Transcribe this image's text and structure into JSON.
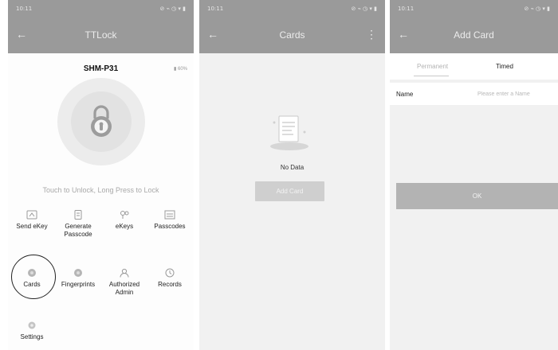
{
  "screen1": {
    "status": {
      "time": "10:11",
      "icons": "⊘ ⌁ ◷ ▾ ▮"
    },
    "appbar": {
      "back_icon": "arrow-left-icon",
      "title": "TTLock"
    },
    "device_name": "SHM-P31",
    "battery": "▮ 60%",
    "touch_hint": "Touch to Unlock, Long Press to Lock",
    "menu_items": [
      {
        "label": "Send eKey",
        "icon": "ekey-send-icon"
      },
      {
        "label": "Generate Passcode",
        "icon": "generate-passcode-icon"
      },
      {
        "label": "eKeys",
        "icon": "ekeys-icon"
      },
      {
        "label": "Passcodes",
        "icon": "passcodes-icon"
      },
      {
        "label": "Cards",
        "icon": "card-icon"
      },
      {
        "label": "Fingerprints",
        "icon": "fingerprint-icon"
      },
      {
        "label": "Authorized Admin",
        "icon": "admin-icon"
      },
      {
        "label": "Records",
        "icon": "records-icon"
      },
      {
        "label": "Settings",
        "icon": "settings-icon"
      }
    ]
  },
  "screen2": {
    "status": {
      "time": "10:11",
      "icons": "⊘ ⌁ ◷ ▾ ▮"
    },
    "appbar": {
      "back_icon": "arrow-left-icon",
      "title": "Cards",
      "more_icon": "more-vertical-icon"
    },
    "empty_text": "No Data",
    "add_button": "Add Card"
  },
  "screen3": {
    "status": {
      "time": "10:11",
      "icons": "⊘ ⌁ ◷ ▾ ▮"
    },
    "appbar": {
      "back_icon": "arrow-left-icon",
      "title": "Add Card"
    },
    "tabs": [
      "Permanent",
      "Timed"
    ],
    "name_label": "Name",
    "name_placeholder": "Please enter a Name",
    "ok_button": "OK"
  },
  "colors": {
    "header_gray": "#9a9a9a",
    "button_disabled": "#cfcfcf",
    "ok_gray": "#b3b3b3",
    "page_bg": "#f1f1f1"
  }
}
